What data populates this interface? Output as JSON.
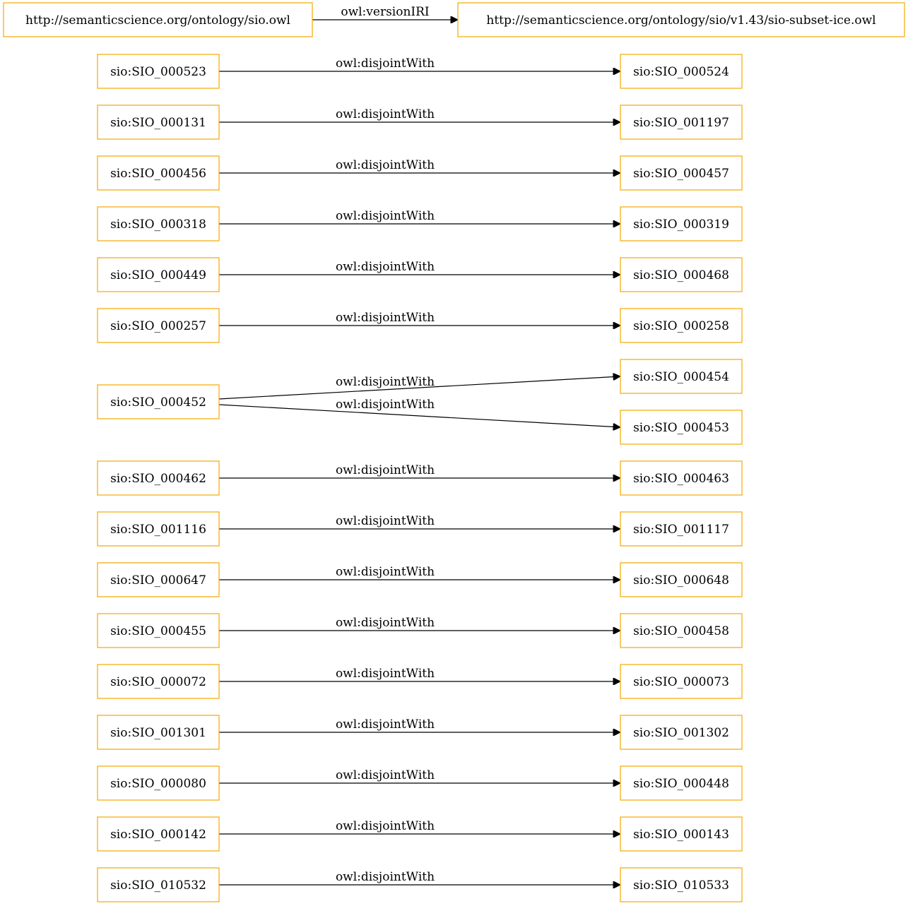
{
  "colors": {
    "node_border": "#f5a800",
    "edge": "#000000",
    "background": "#ffffff"
  },
  "nodes": [
    {
      "id": "sio_owl",
      "label": "http://semanticscience.org/ontology/sio.owl"
    },
    {
      "id": "sio_v143",
      "label": "http://semanticscience.org/ontology/sio/v1.43/sio-subset-ice.owl"
    },
    {
      "id": "n000523",
      "label": "sio:SIO_000523"
    },
    {
      "id": "n000524",
      "label": "sio:SIO_000524"
    },
    {
      "id": "n000131",
      "label": "sio:SIO_000131"
    },
    {
      "id": "n001197",
      "label": "sio:SIO_001197"
    },
    {
      "id": "n000456",
      "label": "sio:SIO_000456"
    },
    {
      "id": "n000457",
      "label": "sio:SIO_000457"
    },
    {
      "id": "n000318",
      "label": "sio:SIO_000318"
    },
    {
      "id": "n000319",
      "label": "sio:SIO_000319"
    },
    {
      "id": "n000449",
      "label": "sio:SIO_000449"
    },
    {
      "id": "n000468",
      "label": "sio:SIO_000468"
    },
    {
      "id": "n000257",
      "label": "sio:SIO_000257"
    },
    {
      "id": "n000258",
      "label": "sio:SIO_000258"
    },
    {
      "id": "n000452",
      "label": "sio:SIO_000452"
    },
    {
      "id": "n000454",
      "label": "sio:SIO_000454"
    },
    {
      "id": "n000453",
      "label": "sio:SIO_000453"
    },
    {
      "id": "n000462",
      "label": "sio:SIO_000462"
    },
    {
      "id": "n000463",
      "label": "sio:SIO_000463"
    },
    {
      "id": "n001116",
      "label": "sio:SIO_001116"
    },
    {
      "id": "n001117",
      "label": "sio:SIO_001117"
    },
    {
      "id": "n000647",
      "label": "sio:SIO_000647"
    },
    {
      "id": "n000648",
      "label": "sio:SIO_000648"
    },
    {
      "id": "n000455",
      "label": "sio:SIO_000455"
    },
    {
      "id": "n000458",
      "label": "sio:SIO_000458"
    },
    {
      "id": "n000072",
      "label": "sio:SIO_000072"
    },
    {
      "id": "n000073",
      "label": "sio:SIO_000073"
    },
    {
      "id": "n001301",
      "label": "sio:SIO_001301"
    },
    {
      "id": "n001302",
      "label": "sio:SIO_001302"
    },
    {
      "id": "n000080",
      "label": "sio:SIO_000080"
    },
    {
      "id": "n000448",
      "label": "sio:SIO_000448"
    },
    {
      "id": "n000142",
      "label": "sio:SIO_000142"
    },
    {
      "id": "n000143",
      "label": "sio:SIO_000143"
    },
    {
      "id": "n010532",
      "label": "sio:SIO_010532"
    },
    {
      "id": "n010533",
      "label": "sio:SIO_010533"
    }
  ],
  "edges": [
    {
      "from": "sio_owl",
      "to": "sio_v143",
      "label": "owl:versionIRI"
    },
    {
      "from": "n000523",
      "to": "n000524",
      "label": "owl:disjointWith"
    },
    {
      "from": "n000131",
      "to": "n001197",
      "label": "owl:disjointWith"
    },
    {
      "from": "n000456",
      "to": "n000457",
      "label": "owl:disjointWith"
    },
    {
      "from": "n000318",
      "to": "n000319",
      "label": "owl:disjointWith"
    },
    {
      "from": "n000449",
      "to": "n000468",
      "label": "owl:disjointWith"
    },
    {
      "from": "n000257",
      "to": "n000258",
      "label": "owl:disjointWith"
    },
    {
      "from": "n000452",
      "to": "n000454",
      "label": "owl:disjointWith"
    },
    {
      "from": "n000452",
      "to": "n000453",
      "label": "owl:disjointWith"
    },
    {
      "from": "n000462",
      "to": "n000463",
      "label": "owl:disjointWith"
    },
    {
      "from": "n001116",
      "to": "n001117",
      "label": "owl:disjointWith"
    },
    {
      "from": "n000647",
      "to": "n000648",
      "label": "owl:disjointWith"
    },
    {
      "from": "n000455",
      "to": "n000458",
      "label": "owl:disjointWith"
    },
    {
      "from": "n000072",
      "to": "n000073",
      "label": "owl:disjointWith"
    },
    {
      "from": "n001301",
      "to": "n001302",
      "label": "owl:disjointWith"
    },
    {
      "from": "n000080",
      "to": "n000448",
      "label": "owl:disjointWith"
    },
    {
      "from": "n000142",
      "to": "n000143",
      "label": "owl:disjointWith"
    },
    {
      "from": "n010532",
      "to": "n010533",
      "label": "owl:disjointWith"
    }
  ]
}
